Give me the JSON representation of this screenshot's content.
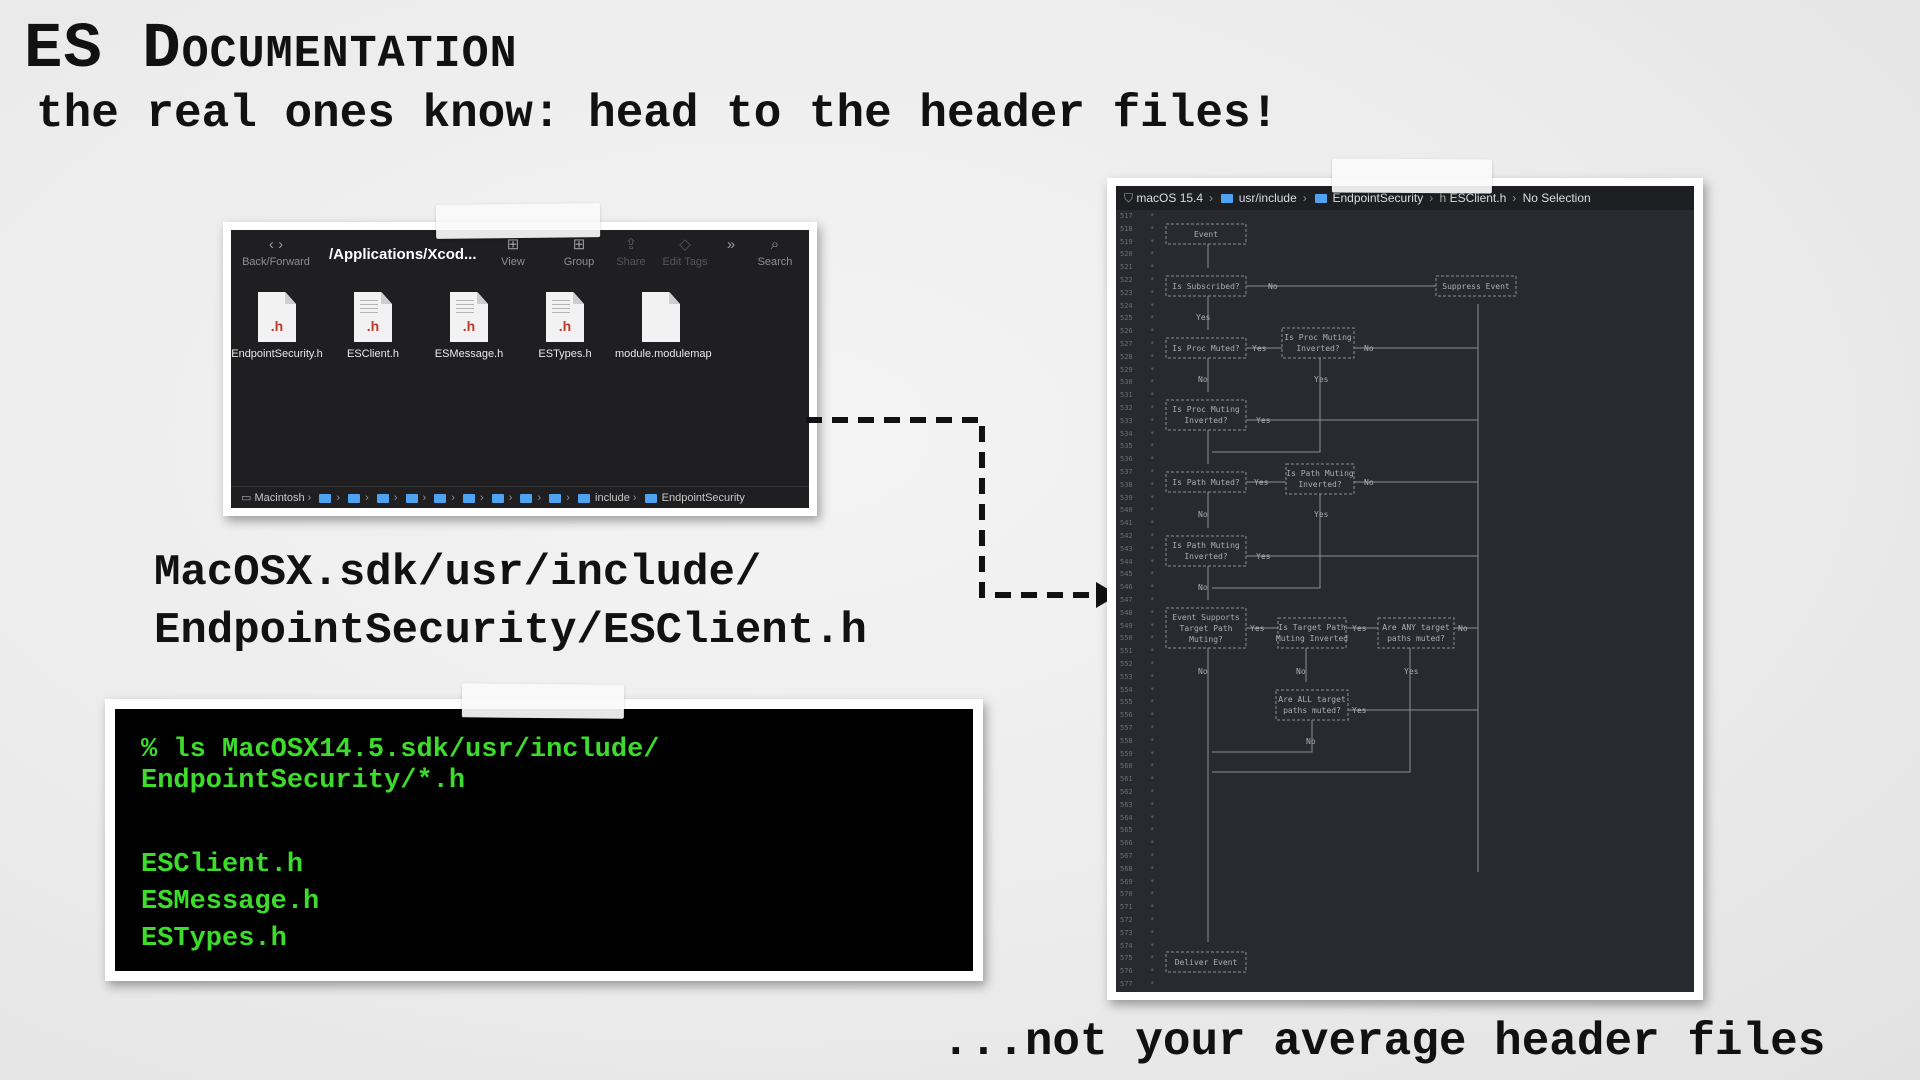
{
  "slide": {
    "title": "ES Documentation",
    "subtitle": "the real ones know: head to the header files!",
    "path_line1": "MacOSX.sdk/usr/include/",
    "path_line2": "EndpointSecurity/ESClient.h",
    "tagline": "...not your average header files"
  },
  "finder": {
    "path_title": "/Applications/Xcod...",
    "toolbar": {
      "back_forward": "Back/Forward",
      "view": "View",
      "group": "Group",
      "share": "Share",
      "edit_tags": "Edit Tags",
      "search": "Search"
    },
    "files": [
      {
        "name": "EndpointSecurity.h",
        "ext": ".h"
      },
      {
        "name": "ESClient.h",
        "ext": ".h"
      },
      {
        "name": "ESMessage.h",
        "ext": ".h"
      },
      {
        "name": "ESTypes.h",
        "ext": ".h"
      },
      {
        "name": "module.modulemap",
        "ext": ""
      }
    ],
    "status": {
      "disk": "Macintosh",
      "include": "include",
      "endpoint": "EndpointSecurity"
    }
  },
  "terminal": {
    "command_line1": "% ls MacOSX14.5.sdk/usr/include/",
    "command_line2": "EndpointSecurity/*.h",
    "files": [
      "ESClient.h",
      "ESMessage.h",
      "ESTypes.h"
    ]
  },
  "xcode": {
    "breadcrumbs": [
      "macOS 15.4",
      "usr/include",
      "EndpointSecurity",
      "ESClient.h",
      "No Selection"
    ],
    "line_start": 517,
    "line_end": 577,
    "flowchart": {
      "nodes": {
        "event": "Event",
        "is_subscribed": "Is Subscribed?",
        "suppress": "Suppress Event",
        "proc_muted": "Is Proc Muted?",
        "proc_inv_a1": "Is Proc Muting",
        "proc_inv_a2": "Inverted?",
        "proc_inv_b1": "Is Proc Muting",
        "proc_inv_b2": "Inverted?",
        "path_muted": "Is Path Muted?",
        "path_inv_a1": "Is Path Muting",
        "path_inv_a2": "Inverted?",
        "path_inv_b1": "Is Path Muting",
        "path_inv_b2": "Inverted?",
        "supports1": "Event Supports",
        "supports2": "Target Path",
        "supports3": "Muting?",
        "tpath1": "Is Target Path",
        "tpath2": "Muting Inverted",
        "any1": "Are ANY target",
        "any2": "paths muted?",
        "all1": "Are ALL target",
        "all2": "paths muted?",
        "deliver": "Deliver Event"
      },
      "labels": {
        "yes": "Yes",
        "no": "No"
      }
    }
  }
}
